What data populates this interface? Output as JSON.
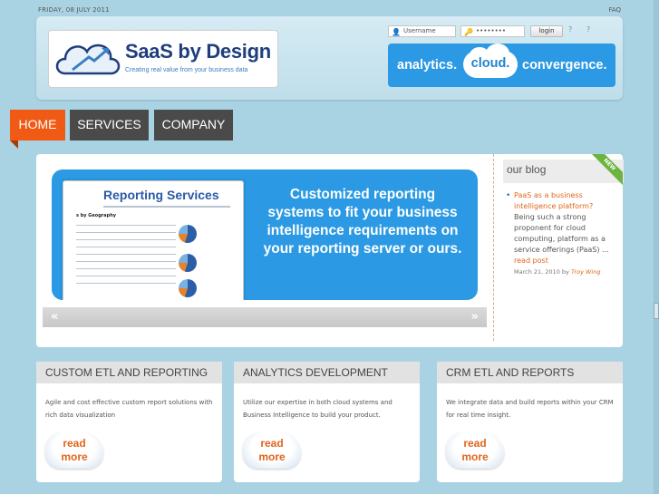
{
  "topbar": {
    "date": "FRIDAY, 08 JULY 2011",
    "faq": "FAQ"
  },
  "header": {
    "logo_title": "SaaS by Design",
    "logo_tagline": "Creating real value from your business data",
    "login": {
      "username_placeholder": "Username",
      "password_value": "••••••••",
      "login_label": "login",
      "help1": "?",
      "help2": "?"
    },
    "banner": {
      "part1": "analytics.",
      "part2": "cloud.",
      "part3": "convergence."
    }
  },
  "nav": {
    "home": "HOME",
    "services": "SERVICES",
    "company": "COMPANY"
  },
  "slider": {
    "screenshot_title": "Reporting Services",
    "screenshot_subtitle": "s by Geography",
    "text": "Customized reporting systems to fit your business intelligence requirements on  your reporting server or ours.",
    "prev": "«",
    "next": "»"
  },
  "blog": {
    "title": "our blog",
    "badge": "NEW",
    "post": {
      "title": "PaaS as a business intelligence platform?",
      "body": "Being such a strong proponent for cloud computing, platform as a service offerings (PaaS) ...",
      "read_more": "read post",
      "date": "March 21, 2010 by",
      "author": "Troy Wing"
    }
  },
  "cards": [
    {
      "title": "CUSTOM ETL AND REPORTING",
      "body": "Agile and cost effective custom report solutions with rich data visualization",
      "read_more_1": "read",
      "read_more_2": "more"
    },
    {
      "title": "ANALYTICS DEVELOPMENT",
      "body": "Utilize our expertise in both cloud systems and Business Intelligence to build your product.",
      "read_more_1": "read",
      "read_more_2": "more"
    },
    {
      "title": "CRM ETL AND REPORTS",
      "body": "We integrate data and build reports within your CRM for real time insight.",
      "read_more_1": "read",
      "read_more_2": "more"
    }
  ],
  "colors": {
    "accent": "#f05a14",
    "banner": "#2b99e3",
    "nav": "#4a4a4a",
    "background": "#a9d3e3"
  }
}
